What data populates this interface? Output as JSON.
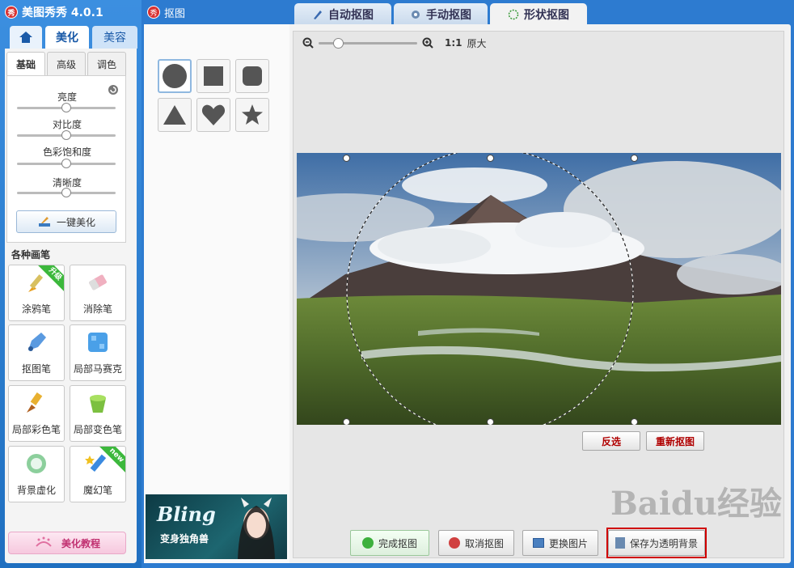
{
  "left_window": {
    "title": "美图秀秀 4.0.1",
    "logo_text": "秀",
    "home_icon": "home-icon",
    "tabs": [
      "美化",
      "美容"
    ],
    "sub_tabs": [
      "基础",
      "高级",
      "调色"
    ],
    "sliders": [
      {
        "label": "亮度",
        "value": 0.5
      },
      {
        "label": "对比度",
        "value": 0.5
      },
      {
        "label": "色彩饱和度",
        "value": 0.5
      },
      {
        "label": "清晰度",
        "value": 0.5
      }
    ],
    "one_key_label": "一键美化",
    "brush_section_title": "各种画笔",
    "tools": [
      {
        "label": "涂鸦笔",
        "badge": "升级",
        "icon": "paintbrush-icon"
      },
      {
        "label": "消除笔",
        "badge": "",
        "icon": "eraser-icon"
      },
      {
        "label": "抠图笔",
        "badge": "",
        "icon": "cutout-pen-icon"
      },
      {
        "label": "局部马赛克",
        "badge": "",
        "icon": "mosaic-icon"
      },
      {
        "label": "局部彩色笔",
        "badge": "",
        "icon": "color-brush-icon"
      },
      {
        "label": "局部变色笔",
        "badge": "",
        "icon": "recolor-bucket-icon"
      },
      {
        "label": "背景虚化",
        "badge": "",
        "icon": "blur-icon"
      },
      {
        "label": "魔幻笔",
        "badge": "new",
        "icon": "magic-pen-icon"
      }
    ],
    "tutorial_label": "美化教程"
  },
  "right_window": {
    "title": "抠图",
    "mode_tabs": [
      {
        "label": "自动抠图",
        "active": false
      },
      {
        "label": "手动抠图",
        "active": false
      },
      {
        "label": "形状抠图",
        "active": true
      }
    ],
    "shapes": [
      "circle",
      "square",
      "rounded-square",
      "triangle",
      "heart",
      "star"
    ],
    "selected_shape": "circle",
    "ad": {
      "brand": "Bling",
      "caption": "变身独角兽"
    },
    "zoom": {
      "ratio": "1:1",
      "label": "原大",
      "level": 0.2
    },
    "canvas_buttons": {
      "invert": "反选",
      "recut": "重新抠图"
    },
    "bottom_buttons": {
      "done": "完成抠图",
      "cancel": "取消抠图",
      "replace": "更换图片",
      "save_transparent": "保存为透明背景"
    },
    "watermark": "Baidu经验"
  },
  "colors": {
    "window_blue": "#2d7bd0",
    "highlight_red": "#d00000",
    "accent_red_text": "#b00000"
  }
}
